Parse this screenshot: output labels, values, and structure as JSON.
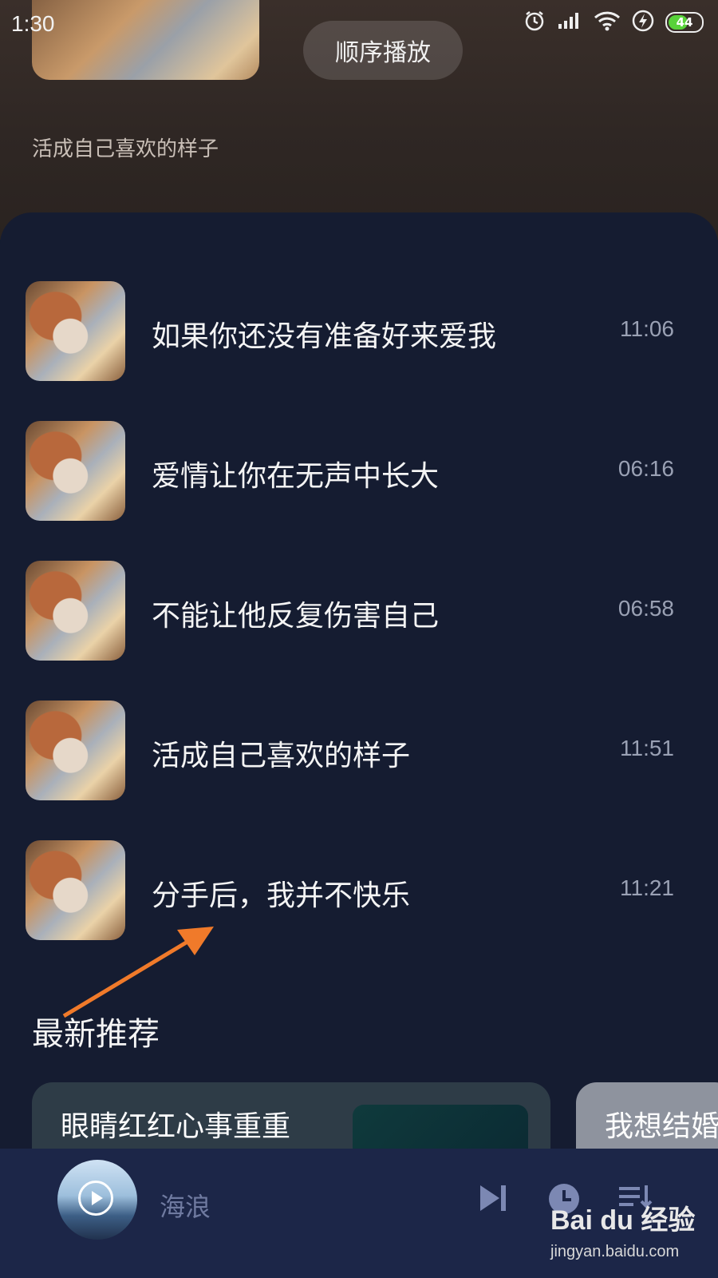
{
  "status_bar": {
    "time": "1:30",
    "battery": "44"
  },
  "header": {
    "order_button": "顺序播放",
    "subtitle": "活成自己喜欢的样子"
  },
  "tracks": [
    {
      "title": "如果你还没有准备好来爱我",
      "duration": "11:06"
    },
    {
      "title": "爱情让你在无声中长大",
      "duration": "06:16"
    },
    {
      "title": "不能让他反复伤害自己",
      "duration": "06:58"
    },
    {
      "title": "活成自己喜欢的样子",
      "duration": "11:51"
    },
    {
      "title": "分手后，我并不快乐",
      "duration": "11:21"
    }
  ],
  "recommend": {
    "title": "最新推荐",
    "cards": [
      {
        "title": "眼睛红红心事重重"
      },
      {
        "title": "我想结婚"
      }
    ]
  },
  "player": {
    "song": "海浪"
  },
  "watermark": {
    "logo": "Bai du 经验",
    "url": "jingyan.baidu.com"
  },
  "colors": {
    "accent_arrow": "#f07a2a",
    "panel_bg": "#151c31",
    "player_bg": "#1c2648"
  }
}
